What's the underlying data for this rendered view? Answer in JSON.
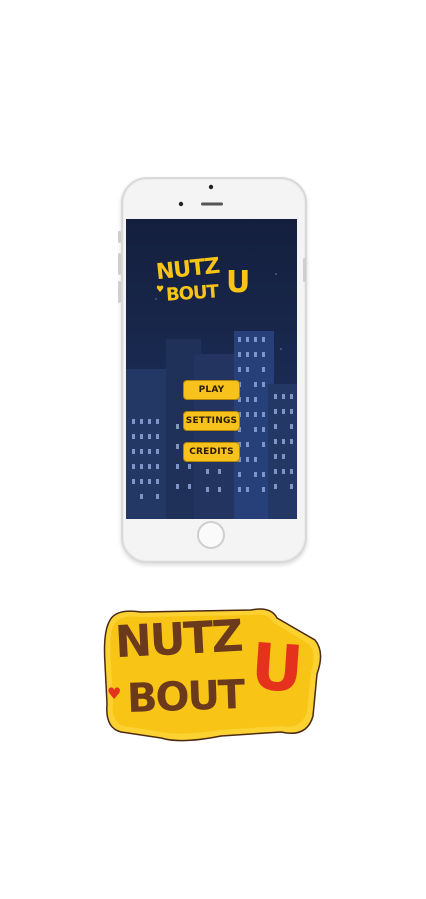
{
  "game": {
    "logo_line1": "NUTZ",
    "logo_line2": "BOUT",
    "logo_u": "U"
  },
  "menu": {
    "play": "PLAY",
    "settings": "SETTINGS",
    "credits": "CREDITS"
  },
  "colors": {
    "button": "#f6c21b",
    "sky_top": "#141f3d",
    "sky_bottom": "#203868",
    "logo_yellow": "#f8c516",
    "logo_brown": "#6b3a1c",
    "logo_red": "#e5321d"
  }
}
